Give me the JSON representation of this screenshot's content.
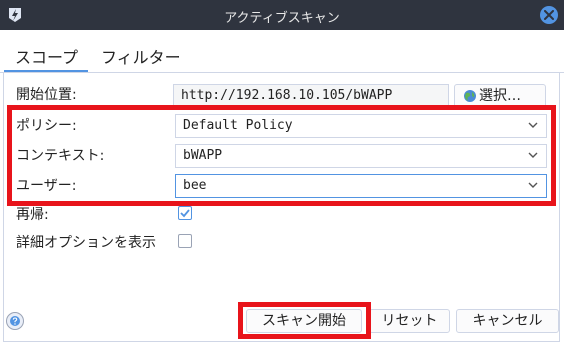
{
  "window": {
    "title": "アクティブスキャン"
  },
  "tabs": [
    {
      "label": "スコープ"
    },
    {
      "label": "フィルター"
    }
  ],
  "form": {
    "start_label": "開始位置:",
    "start_value": "http://192.168.10.105/bWAPP",
    "select_button": "選択…",
    "policy_label": "ポリシー:",
    "policy_value": "Default Policy",
    "context_label": "コンテキスト:",
    "context_value": "bWAPP",
    "user_label": "ユーザー:",
    "user_value": "bee",
    "recurse_label": "再帰:",
    "recurse_checked": true,
    "advanced_label": "詳細オプションを表示",
    "advanced_checked": false
  },
  "buttons": {
    "start_scan": "スキャン開始",
    "reset": "リセット",
    "cancel": "キャンセル"
  },
  "colors": {
    "accent": "#5294e2",
    "highlight": "#e8141b",
    "titlebar": "#2f343f"
  },
  "icons": {
    "app": "zap-app-icon",
    "close": "close-icon",
    "globe": "globe-icon",
    "help": "help-icon",
    "chevron": "chevron-down-icon",
    "check": "check-icon"
  }
}
